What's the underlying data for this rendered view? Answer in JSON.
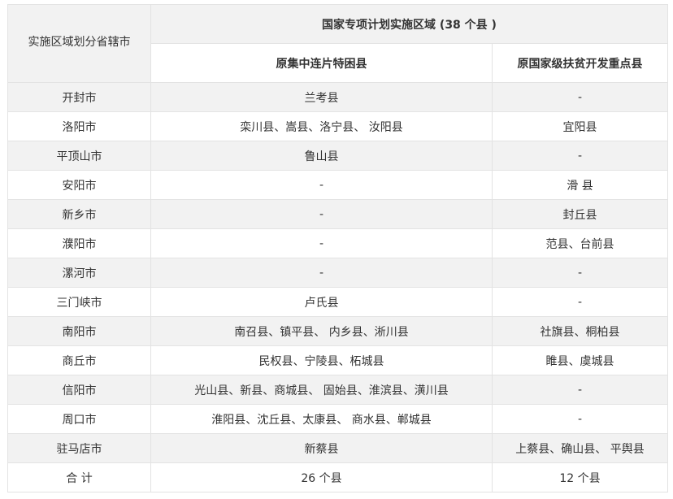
{
  "table": {
    "header": {
      "region": "实施区域划分省辖市",
      "group": "国家专项计划实施区域 (38 个县 )",
      "col_a": "原集中连片特困县",
      "col_b": "原国家级扶贫开发重点县"
    },
    "rows": [
      {
        "city": "开封市",
        "a": "兰考县",
        "b": "-"
      },
      {
        "city": "洛阳市",
        "a": "栾川县、嵩县、洛宁县、 汝阳县",
        "b": "宜阳县"
      },
      {
        "city": "平顶山市",
        "a": "鲁山县",
        "b": "-"
      },
      {
        "city": "安阳市",
        "a": "-",
        "b": "滑 县"
      },
      {
        "city": "新乡市",
        "a": "-",
        "b": "封丘县"
      },
      {
        "city": "濮阳市",
        "a": "-",
        "b": "范县、台前县"
      },
      {
        "city": "漯河市",
        "a": "-",
        "b": "-"
      },
      {
        "city": "三门峡市",
        "a": "卢氏县",
        "b": "-"
      },
      {
        "city": "南阳市",
        "a": "南召县、镇平县、 内乡县、淅川县",
        "b": "社旗县、桐柏县"
      },
      {
        "city": "商丘市",
        "a": "民权县、宁陵县、柘城县",
        "b": "睢县、虞城县"
      },
      {
        "city": "信阳市",
        "a": "光山县、新县、商城县、 固始县、淮滨县、潢川县",
        "b": "-"
      },
      {
        "city": "周口市",
        "a": "淮阳县、沈丘县、太康县、 商水县、郸城县",
        "b": "-"
      },
      {
        "city": "驻马店市",
        "a": "新蔡县",
        "b": "上蔡县、确山县、 平舆县"
      },
      {
        "city": "合 计",
        "a": "26 个县",
        "b": "12 个县"
      }
    ]
  }
}
